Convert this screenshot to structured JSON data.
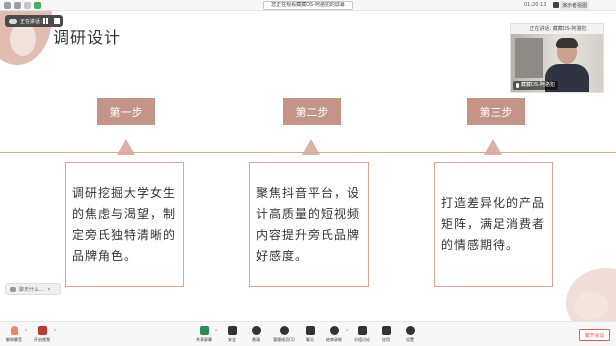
{
  "topbar": {
    "window_title": "您正在观看藏藏DS-阿骆犯的屏幕",
    "time": "01:20:13",
    "view_button": "演示者视图"
  },
  "speaking_pill": {
    "label": "正在讲话："
  },
  "slide": {
    "title": "调研设计",
    "steps": [
      {
        "badge": "第一步",
        "text": "调研挖掘大学女生的焦虑与渴望，制定旁氏独特清晰的品牌角色。"
      },
      {
        "badge": "第二步",
        "text": "聚焦抖音平台，设计高质量的短视频内容提升旁氏品牌好感度。"
      },
      {
        "badge": "第三步",
        "text": "打造差异化的产品矩阵，满足消费者的情感期待。"
      }
    ]
  },
  "video": {
    "sharing_banner": "正在讲话: 藏藏DS-阿骆犯",
    "participant_name": "藏藏DS-阿骆犯"
  },
  "chat_toast": {
    "placeholder": "聊天什么..."
  },
  "toolbar": {
    "mic_label": "解除静音",
    "camera_label": "开启视频",
    "items": [
      {
        "label": "共享屏幕",
        "icon": "share-screen-icon"
      },
      {
        "label": "安全",
        "icon": "shield-icon"
      },
      {
        "label": "邀请",
        "icon": "invite-icon"
      },
      {
        "label": "管理成员(1)",
        "icon": "members-icon"
      },
      {
        "label": "聊天",
        "icon": "chat-icon"
      },
      {
        "label": "结束录制",
        "icon": "record-icon"
      },
      {
        "label": "分组讨论",
        "icon": "breakout-icon"
      },
      {
        "label": "应用",
        "icon": "apps-icon"
      },
      {
        "label": "设置",
        "icon": "gear-icon"
      }
    ],
    "end_button": "离开会议"
  },
  "colors": {
    "accent": "#c49486",
    "accent_light": "#d9b1a6",
    "line": "#d9a79b",
    "end_red": "#e35b5b"
  }
}
